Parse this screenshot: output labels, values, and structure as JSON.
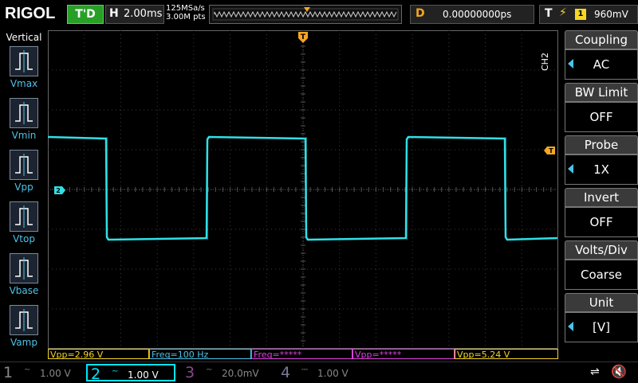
{
  "brand": {
    "logo": "RIGOL"
  },
  "top_bar": {
    "run_status": "T'D",
    "timebase_label": "H",
    "timebase_value": "2.00ms",
    "sample_rate": "125MSa/s",
    "memory_depth": "3.00M pts",
    "delay_label": "D",
    "delay_value": "0.00000000ps",
    "trigger_label": "T",
    "trigger_source": "1",
    "trigger_level": "960mV"
  },
  "left_panel": {
    "title": "Vertical",
    "items": [
      {
        "label": "Vmax"
      },
      {
        "label": "Vmin"
      },
      {
        "label": "Vpp"
      },
      {
        "label": "Vtop"
      },
      {
        "label": "Vbase"
      },
      {
        "label": "Vamp"
      }
    ]
  },
  "right_menu": {
    "channel": "CH2",
    "items": [
      {
        "title": "Coupling",
        "value": "AC"
      },
      {
        "title": "BW Limit",
        "value": "OFF"
      },
      {
        "title": "Probe",
        "value": "1X"
      },
      {
        "title": "Invert",
        "value": "OFF"
      },
      {
        "title": "Volts/Div",
        "value": "Coarse"
      },
      {
        "title": "Unit",
        "value": "[V]"
      }
    ]
  },
  "measurements": [
    {
      "text": "Vpp=2.96 V",
      "color": "#f5d623"
    },
    {
      "text": "Freq=100 Hz",
      "color": "#4cc3e8"
    },
    {
      "text": "Freq=*****",
      "color": "#e040e0"
    },
    {
      "text": "Vpp=*****",
      "color": "#e040e0"
    },
    {
      "text": "Vpp=5.24 V",
      "color": "#f5d623"
    }
  ],
  "channels": [
    {
      "num": "1",
      "scale": "1.00 V",
      "color": "#f5d623",
      "active": false
    },
    {
      "num": "2",
      "scale": "1.00 V",
      "color": "#00e5ff",
      "active": true
    },
    {
      "num": "3",
      "scale": "20.0mV",
      "color": "#e040e0",
      "active": false
    },
    {
      "num": "4",
      "scale": "1.00 V",
      "color": "#3a6fff",
      "active": false
    }
  ],
  "markers": {
    "trigger_top": "T",
    "trigger_level_right": "T",
    "channel_ref_left": "2"
  },
  "colors": {
    "ch2_trace": "#2fe0e8",
    "grid": "#3c3c3c",
    "trigger": "#f5a623"
  }
}
